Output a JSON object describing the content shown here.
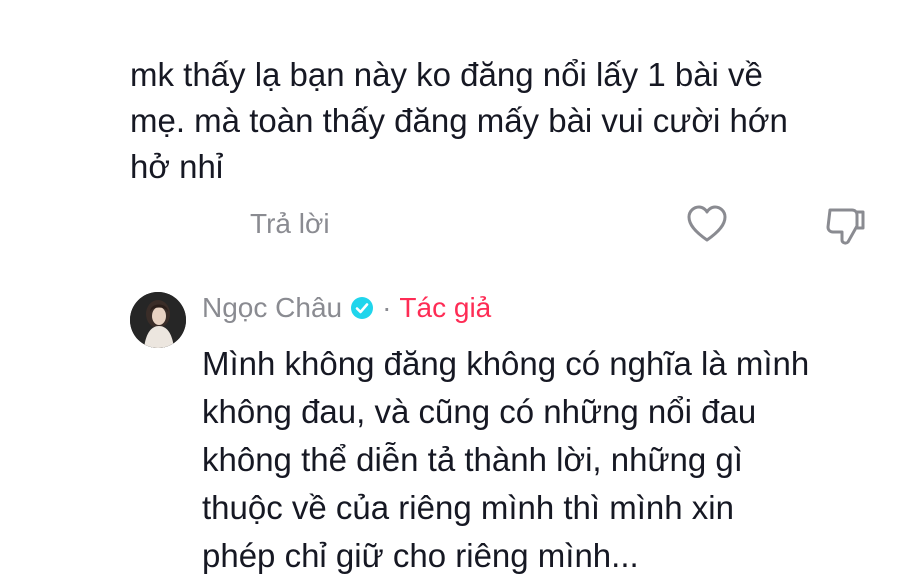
{
  "comment": {
    "lines": [
      "mk thấy lạ bạn này ko đăng nổi lấy 1 bài về",
      "mẹ. mà toàn thấy đăng mấy bài vui cười hớn",
      "hở nhỉ"
    ],
    "reply_label": "Trả lời",
    "like_icon": "heart-outline",
    "dislike_icon": "thumbs-down-outline"
  },
  "reply": {
    "author": "Ngọc Châu",
    "verified_icon": "verified-check",
    "separator": "·",
    "author_tag": "Tác giả",
    "lines": [
      "Mình không đăng không có nghĩa là mình",
      "không đau, và cũng có những nổi đau",
      "không thể diễn tả thành lời, những gì",
      "thuộc về của riêng mình thì mình xin",
      "phép chỉ giữ cho riêng mình..."
    ]
  },
  "colors": {
    "text": "#161823",
    "muted": "#8a8b91",
    "author_tag": "#fe2c55",
    "verified": "#20d5ec"
  }
}
